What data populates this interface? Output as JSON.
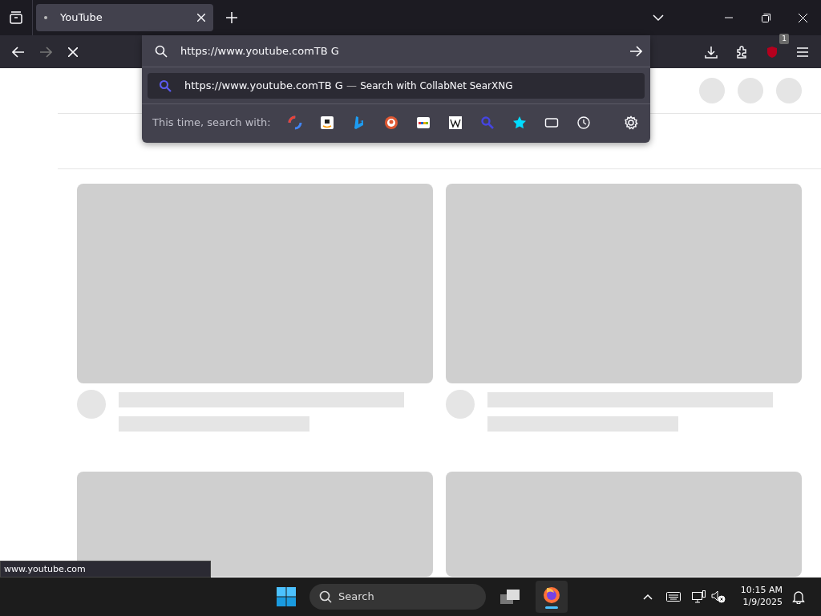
{
  "tabs": [
    {
      "title": "YouTube",
      "selected": true
    }
  ],
  "address_bar": {
    "value": "https://www.youtube.comTB G"
  },
  "suggestion": {
    "text": "https://www.youtube.comTB G",
    "separator": "—",
    "action": "Search with CollabNet SearXNG",
    "selected": true
  },
  "one_off_label": "This time, search with:",
  "extension_badge": "1",
  "status_url": "www.youtube.com",
  "taskbar": {
    "search_placeholder": "Search",
    "time": "10:15 AM",
    "date": "1/9/2025"
  }
}
